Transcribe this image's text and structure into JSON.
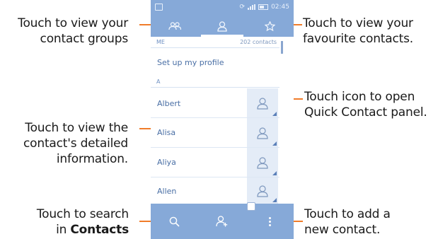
{
  "annotations": {
    "groups": [
      "Touch to view your",
      "contact groups"
    ],
    "favourites": [
      "Touch to view your",
      "favourite contacts."
    ],
    "detail": [
      "Touch to view the",
      "contact's detailed",
      "information."
    ],
    "quick_contact": [
      "Touch icon to open",
      "Quick Contact panel."
    ],
    "search": {
      "line1": "Touch to search",
      "line2_prefix": "in ",
      "line2_bold": "Contacts"
    },
    "add": [
      "Touch to add a",
      "new contact."
    ]
  },
  "status_bar": {
    "time": "02:45"
  },
  "tabs": [
    {
      "name": "groups",
      "icon": "groups-icon"
    },
    {
      "name": "contacts",
      "icon": "person-icon",
      "active": true
    },
    {
      "name": "favourites",
      "icon": "star-icon"
    }
  ],
  "me_section": {
    "label": "ME",
    "count": "202 contacts",
    "profile_label": "Set up my profile"
  },
  "a_section": {
    "label": "A"
  },
  "contacts": [
    "Albert",
    "Alisa",
    "Aliya",
    "Allen"
  ],
  "bottom_bar": {
    "icons": [
      "search-icon",
      "add-contact-icon",
      "overflow-menu-icon"
    ]
  },
  "colors": {
    "accent": "#86a9d8",
    "leader": "#f07c2a",
    "text": "#4a6fa5"
  }
}
